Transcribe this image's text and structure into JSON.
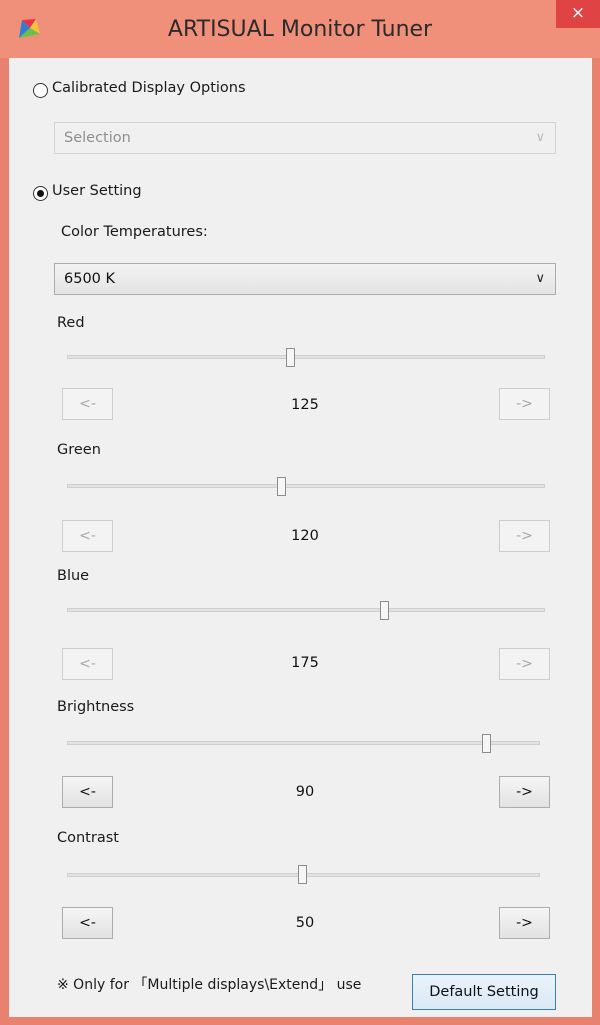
{
  "window": {
    "title": "ARTISUAL Monitor Tuner",
    "close_glyph": "×",
    "icon": "color-fan-icon"
  },
  "options": {
    "calibrated": {
      "label": "Calibrated Display Options",
      "selected": false
    },
    "calibrated_select": {
      "value": "Selection",
      "enabled": false
    },
    "user": {
      "label": "User Setting",
      "selected": true
    }
  },
  "color_temp": {
    "label": "Color Temperatures:",
    "value": "6500 K"
  },
  "chevron": "∨",
  "sliders": {
    "red": {
      "label": "Red",
      "value": "125",
      "dec": "<-",
      "inc": "->",
      "enabled": false
    },
    "green": {
      "label": "Green",
      "value": "120",
      "dec": "<-",
      "inc": "->",
      "enabled": false
    },
    "blue": {
      "label": "Blue",
      "value": "175",
      "dec": "<-",
      "inc": "->",
      "enabled": false
    },
    "brightness": {
      "label": "Brightness",
      "value": "90",
      "dec": "<-",
      "inc": "->",
      "enabled": true
    },
    "contrast": {
      "label": "Contrast",
      "value": "50",
      "dec": "<-",
      "inc": "->",
      "enabled": true
    }
  },
  "footer": {
    "note": "※ Only for 「Multiple displays\\Extend」 use",
    "default_button": "Default Setting"
  }
}
